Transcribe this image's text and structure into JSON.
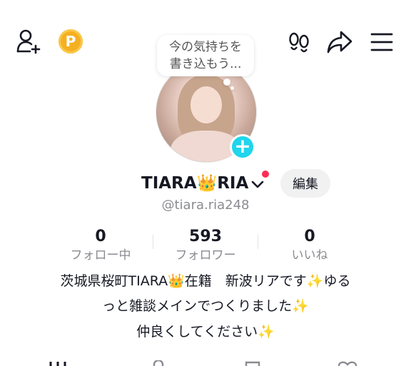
{
  "topbar": {
    "add_user_icon": "add-user-icon",
    "coin_label": "P",
    "coin_color": "#f5b021",
    "footprints_icon": "footprints-icon",
    "share_icon": "share-icon",
    "menu_icon": "hamburger-menu-icon"
  },
  "bubble": {
    "line1": "今の気持ちを",
    "line2": "書き込もう..."
  },
  "profile": {
    "name": "TIARA👑RIA",
    "username": "@tiara.ria248",
    "edit_label": "編集",
    "accent_color": "#20d5ec",
    "notification_color": "#fe2c55"
  },
  "stats": [
    {
      "value": "0",
      "label": "フォロー中"
    },
    {
      "value": "593",
      "label": "フォロワー"
    },
    {
      "value": "0",
      "label": "いいね"
    }
  ],
  "bio": {
    "line1": "茨城県桜町TIARA👑在籍　新波リアです✨ゆる",
    "line2": "っと雑談メインでつくりました✨",
    "line3": "仲良くしてください✨"
  }
}
